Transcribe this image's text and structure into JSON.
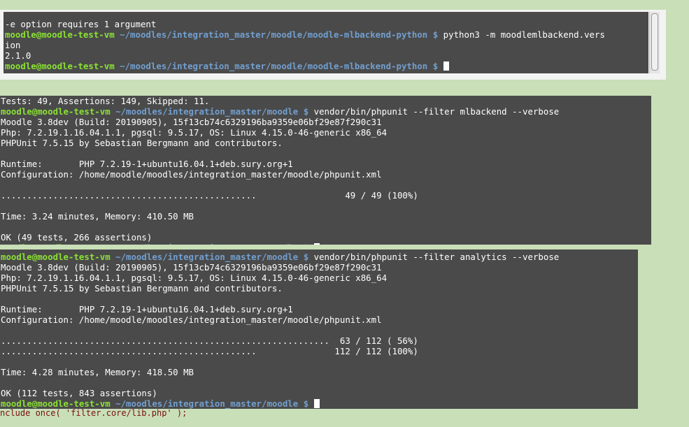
{
  "terminal_top": {
    "lines": [
      "-e option requires 1 argument",
      {
        "user": "moodle@moodle-test-vm",
        "path": "~/moodles/integration_master/moodle/moodle-mlbackend-python",
        "symbol": "$",
        "command": "python3 -m moodlemlbackend.vers"
      },
      "ion",
      "2.1.0",
      {
        "user": "moodle@moodle-test-vm",
        "path": "~/moodles/integration_master/moodle/moodle-mlbackend-python",
        "symbol": "$",
        "command": ""
      }
    ]
  },
  "terminal_middle": {
    "lines": [
      "Tests: 49, Assertions: 149, Skipped: 11.",
      {
        "user": "moodle@moodle-test-vm",
        "path": "~/moodles/integration_master/moodle",
        "symbol": "$",
        "command": "vendor/bin/phpunit --filter mlbackend --verbose"
      },
      "Moodle 3.8dev (Build: 20190905), 15f13cb74c6329196ba9359e06bf29e87f290c31",
      "Php: 7.2.19.1.16.04.1.1, pgsql: 9.5.17, OS: Linux 4.15.0-46-generic x86_64",
      "PHPUnit 7.5.15 by Sebastian Bergmann and contributors.",
      "",
      "Runtime:       PHP 7.2.19-1+ubuntu16.04.1+deb.sury.org+1",
      "Configuration: /home/moodle/moodles/integration_master/moodle/phpunit.xml",
      "",
      ".................................................                 49 / 49 (100%)",
      "",
      "Time: 3.24 minutes, Memory: 410.50 MB",
      "",
      "OK (49 tests, 266 assertions)",
      {
        "user": "moodle@moodle-test-vm",
        "path": "~/moodles/integration_master/moodle",
        "symbol": "$",
        "command": ""
      }
    ]
  },
  "terminal_bottom": {
    "lines": [
      {
        "user": "moodle@moodle-test-vm",
        "path": "~/moodles/integration_master/moodle",
        "symbol": "$",
        "command": "vendor/bin/phpunit --filter analytics --verbose"
      },
      "Moodle 3.8dev (Build: 20190905), 15f13cb74c6329196ba9359e06bf29e87f290c31",
      "Php: 7.2.19.1.16.04.1.1, pgsql: 9.5.17, OS: Linux 4.15.0-46-generic x86_64",
      "PHPUnit 7.5.15 by Sebastian Bergmann and contributors.",
      "",
      "Runtime:       PHP 7.2.19-1+ubuntu16.04.1+deb.sury.org+1",
      "Configuration: /home/moodle/moodles/integration_master/moodle/phpunit.xml",
      "",
      "...............................................................  63 / 112 ( 56%)",
      ".................................................               112 / 112 (100%)",
      "",
      "Time: 4.28 minutes, Memory: 418.50 MB",
      "",
      "OK (112 tests, 843 assertions)",
      {
        "user": "moodle@moodle-test-vm",
        "path": "~/moodles/integration_master/moodle",
        "symbol": "$",
        "command": ""
      }
    ]
  },
  "background_fragment": "nclude_once( 'filter.core/lib.php' );",
  "colors": {
    "terminal_bg": "#4a4a4a",
    "prompt_user": "#8ae234",
    "prompt_path": "#729fcf",
    "desktop_bg": "#c9dfb8"
  }
}
